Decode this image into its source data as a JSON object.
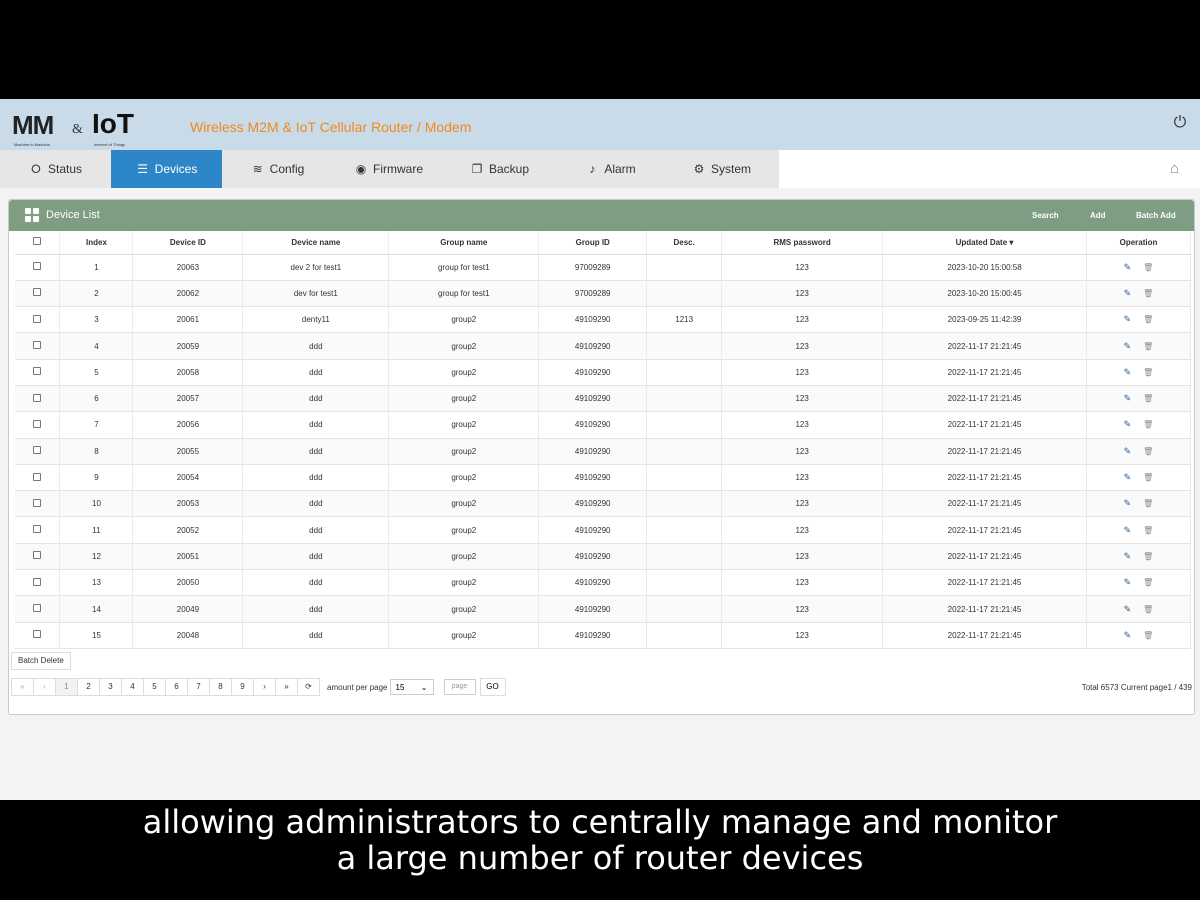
{
  "header": {
    "logo_mm": "MM",
    "logo_amp": "&",
    "logo_iot": "IoT",
    "logo_sub_left": "Machine to Machine",
    "logo_sub_right": "Internet of Things",
    "title": "Wireless M2M & IoT Cellular Router / Modem",
    "power_icon": "power-icon"
  },
  "nav": {
    "tabs": [
      {
        "label": "Status",
        "icon": "status-icon"
      },
      {
        "label": "Devices",
        "icon": "devices-icon",
        "active": true
      },
      {
        "label": "Config",
        "icon": "layers-icon"
      },
      {
        "label": "Firmware",
        "icon": "firmware-icon"
      },
      {
        "label": "Backup",
        "icon": "backup-icon"
      },
      {
        "label": "Alarm",
        "icon": "bell-icon"
      },
      {
        "label": "System",
        "icon": "gear-icon"
      }
    ],
    "home_icon": "home-icon"
  },
  "panel": {
    "title": "Device List",
    "search": "Search",
    "add": "Add",
    "batch_add": "Batch Add"
  },
  "table": {
    "headers": [
      "Index",
      "Device ID",
      "Device name",
      "Group name",
      "Group ID",
      "Desc.",
      "RMS password",
      "Updated Date",
      "Operation"
    ],
    "rows": [
      [
        "1",
        "20063",
        "dev 2 for test1",
        "group for test1",
        "97009289",
        "",
        "123",
        "2023-10-20 15:00:58"
      ],
      [
        "2",
        "20062",
        "dev for test1",
        "group for test1",
        "97009289",
        "",
        "123",
        "2023-10-20 15:00:45"
      ],
      [
        "3",
        "20061",
        "denty11",
        "group2",
        "49109290",
        "1213",
        "123",
        "2023-09-25 11:42:39"
      ],
      [
        "4",
        "20059",
        "ddd",
        "group2",
        "49109290",
        "",
        "123",
        "2022-11-17 21:21:45"
      ],
      [
        "5",
        "20058",
        "ddd",
        "group2",
        "49109290",
        "",
        "123",
        "2022-11-17 21:21:45"
      ],
      [
        "6",
        "20057",
        "ddd",
        "group2",
        "49109290",
        "",
        "123",
        "2022-11-17 21:21:45"
      ],
      [
        "7",
        "20056",
        "ddd",
        "group2",
        "49109290",
        "",
        "123",
        "2022-11-17 21:21:45"
      ],
      [
        "8",
        "20055",
        "ddd",
        "group2",
        "49109290",
        "",
        "123",
        "2022-11-17 21:21:45"
      ],
      [
        "9",
        "20054",
        "ddd",
        "group2",
        "49109290",
        "",
        "123",
        "2022-11-17 21:21:45"
      ],
      [
        "10",
        "20053",
        "ddd",
        "group2",
        "49109290",
        "",
        "123",
        "2022-11-17 21:21:45"
      ],
      [
        "11",
        "20052",
        "ddd",
        "group2",
        "49109290",
        "",
        "123",
        "2022-11-17 21:21:45"
      ],
      [
        "12",
        "20051",
        "ddd",
        "group2",
        "49109290",
        "",
        "123",
        "2022-11-17 21:21:45"
      ],
      [
        "13",
        "20050",
        "ddd",
        "group2",
        "49109290",
        "",
        "123",
        "2022-11-17 21:21:45"
      ],
      [
        "14",
        "20049",
        "ddd",
        "group2",
        "49109290",
        "",
        "123",
        "2022-11-17 21:21:45"
      ],
      [
        "15",
        "20048",
        "ddd",
        "group2",
        "49109290",
        "",
        "123",
        "2022-11-17 21:21:45"
      ]
    ]
  },
  "footer": {
    "batch_delete": "Batch Delete",
    "pages": [
      "«",
      "‹",
      "1",
      "2",
      "3",
      "4",
      "5",
      "6",
      "7",
      "8",
      "9",
      "›",
      "»",
      "⟳"
    ],
    "current_page": "1",
    "amount_label": "amount per page",
    "per_page": "15",
    "page_placeholder": "page",
    "go": "GO",
    "total": "Total 6573 Current page1 / 439"
  },
  "caption": {
    "line1": "allowing administrators to centrally manage and monitor",
    "line2": "a large number of router devices"
  }
}
